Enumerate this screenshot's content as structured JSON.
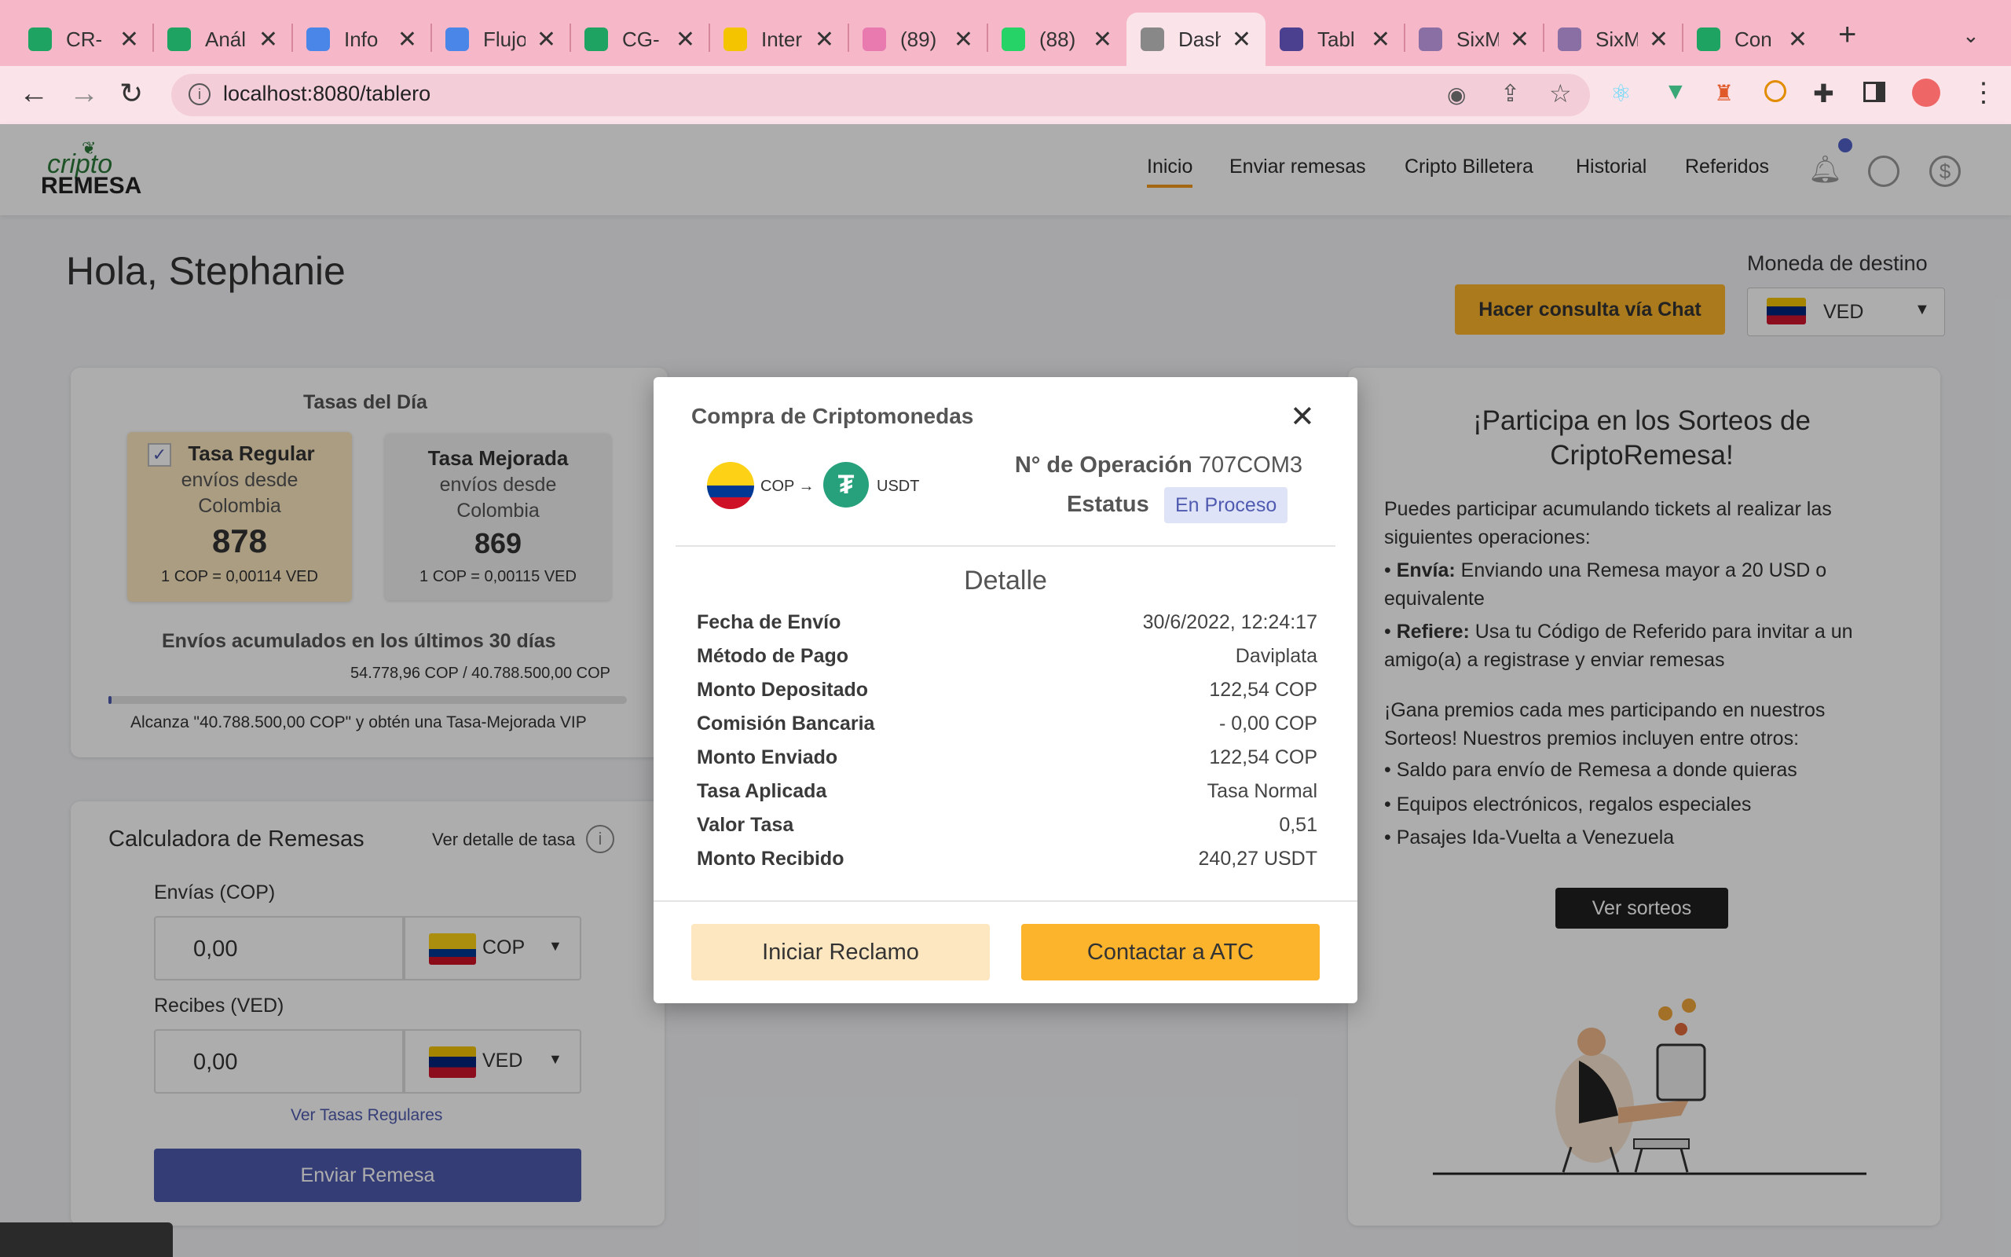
{
  "browser": {
    "tabs": [
      {
        "title": "CR-",
        "color": "#1ea362"
      },
      {
        "title": "Anál",
        "color": "#1ea362"
      },
      {
        "title": "Info",
        "color": "#4a86e8"
      },
      {
        "title": "Flujo",
        "color": "#4a86e8"
      },
      {
        "title": "CG-",
        "color": "#1ea362"
      },
      {
        "title": "Inter",
        "color": "#f4c400"
      },
      {
        "title": "(89)",
        "color": "#e97ab0"
      },
      {
        "title": "(88)",
        "color": "#25d366"
      },
      {
        "title": "Dash",
        "color": "#888888"
      },
      {
        "title": "Tabl",
        "color": "#4b3f8f"
      },
      {
        "title": "SixM",
        "color": "#8a6fa5"
      },
      {
        "title": "SixM",
        "color": "#8a6fa5"
      },
      {
        "title": "Con",
        "color": "#1ea362"
      }
    ],
    "url": "localhost:8080/tablero"
  },
  "app": {
    "logo_top": "cripto",
    "logo_bottom": "REMESA",
    "nav": [
      "Inicio",
      "Enviar remesas",
      "Cripto Billetera",
      "Historial",
      "Referidos"
    ],
    "greeting": "Hola, Stephanie",
    "chat_button": "Hacer consulta vía Chat",
    "dest_label": "Moneda de destino",
    "dest_currency": "VED"
  },
  "rates": {
    "title": "Tasas del Día",
    "regular": {
      "name": "Tasa Regular",
      "sub1": "envíos desde",
      "sub2": "Colombia",
      "value": "878",
      "eq": "1 COP = 0,00114 VED"
    },
    "improved": {
      "name": "Tasa Mejorada",
      "sub1": "envíos desde",
      "sub2": "Colombia",
      "value": "869",
      "eq": "1 COP = 0,00115 VED"
    },
    "accum_title": "Envíos acumulados en los últimos 30 días",
    "accum_value": "54.778,96 COP / 40.788.500,00 COP",
    "accum_progress": 0.0013,
    "accum_hint": "Alcanza \"40.788.500,00 COP\" y obtén una Tasa-Mejorada VIP"
  },
  "calculator": {
    "title": "Calculadora de Remesas",
    "detail_link": "Ver detalle de tasa",
    "send_label": "Envías (COP)",
    "send_value": "0,00",
    "send_currency": "COP",
    "receive_label": "Recibes (VED)",
    "receive_value": "0,00",
    "receive_currency": "VED",
    "regular_link": "Ver Tasas Regulares",
    "submit": "Enviar Remesa"
  },
  "promo": {
    "title": "¡Participa en los Sorteos de CriptoRemesa!",
    "intro": "Puedes participar acumulando tickets al realizar las siguientes operaciones:",
    "b1_key": "Envía:",
    "b1_text": " Enviando una Remesa mayor a 20 USD o equivalente",
    "b2_key": "Refiere:",
    "b2_text": " Usa tu Código de Referido para invitar a un amigo(a) a registrase y enviar remesas",
    "prizes_intro": "¡Gana premios cada mes participando en nuestros Sorteos! Nuestros premios incluyen entre otros:",
    "prizes": [
      "Saldo para envío de Remesa a donde quieras",
      "Equipos electrónicos, regalos especiales",
      "Pasajes Ida-Vuelta a Venezuela"
    ],
    "button": "Ver sorteos"
  },
  "modal": {
    "title": "Compra de Criptomonedas",
    "from": "COP",
    "arrow": "→",
    "to": "USDT",
    "op_label": "N° de Operación",
    "op_value": "707COM3",
    "status_label": "Estatus",
    "status_value": "En Proceso",
    "detail_title": "Detalle",
    "rows": [
      {
        "k": "Fecha de Envío",
        "v": "30/6/2022, 12:24:17"
      },
      {
        "k": "Método de Pago",
        "v": "Daviplata"
      },
      {
        "k": "Monto Depositado",
        "v": "122,54 COP"
      },
      {
        "k": "Comisión Bancaria",
        "v": "- 0,00 COP"
      },
      {
        "k": "Monto Enviado",
        "v": "122,54 COP"
      },
      {
        "k": "Tasa Aplicada",
        "v": "Tasa Normal"
      },
      {
        "k": "Valor Tasa",
        "v": "0,51"
      },
      {
        "k": "Monto Recibido",
        "v": "240,27 USDT"
      }
    ],
    "btn_claim": "Iniciar Reclamo",
    "btn_contact": "Contactar a ATC"
  },
  "colors": {
    "accent": "#fbb42c",
    "primary": "#4f5bb0",
    "status_bg": "#dfe3f7"
  }
}
